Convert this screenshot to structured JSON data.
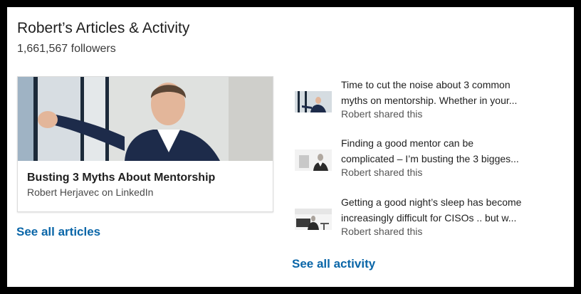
{
  "header": {
    "title": "Robert’s Articles & Activity",
    "followers": "1,661,567 followers"
  },
  "article": {
    "title": "Busting 3 Myths About Mentorship",
    "author": "Robert Herjavec on LinkedIn"
  },
  "see_all_articles": "See all articles",
  "activity": [
    {
      "line1": "Time to cut the noise about 3 common",
      "line2": "myths on mentorship. Whether in your...",
      "meta": "Robert shared this"
    },
    {
      "line1": "Finding a good mentor can be",
      "line2": "complicated – I’m busting the 3 bigges...",
      "meta": "Robert shared this"
    },
    {
      "line1": "Getting a good night’s sleep has become",
      "line2": "increasingly difficult for CISOs .. but w...",
      "meta": "Robert shared this"
    }
  ],
  "see_all_activity": "See all activity",
  "colors": {
    "link": "#0a66a8",
    "text": "#1f1f1f",
    "muted": "#555555"
  }
}
